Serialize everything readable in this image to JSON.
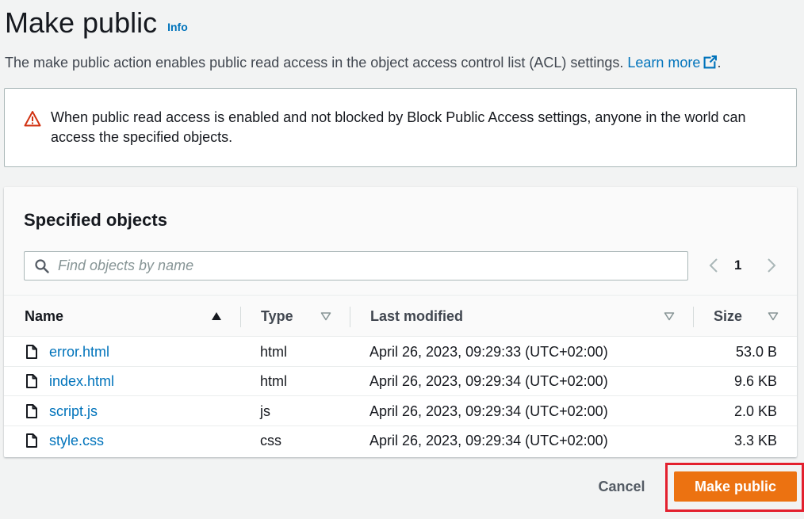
{
  "header": {
    "title": "Make public",
    "info_label": "Info"
  },
  "description": {
    "text": "The make public action enables public read access in the object access control list (ACL) settings. ",
    "learn_more": "Learn more",
    "trailing": "."
  },
  "alert": {
    "type": "warning",
    "text": "When public read access is enabled and not blocked by Block Public Access settings, anyone in the world can access the specified objects."
  },
  "objects_panel": {
    "title": "Specified objects",
    "search_placeholder": "Find objects by name",
    "search_value": "",
    "page_number": "1",
    "columns": {
      "name": "Name",
      "type": "Type",
      "last_modified": "Last modified",
      "size": "Size"
    },
    "sort": {
      "column": "Name",
      "direction": "ascending"
    },
    "rows": [
      {
        "name": "error.html",
        "type": "html",
        "last_modified": "April 26, 2023, 09:29:33 (UTC+02:00)",
        "size": "53.0 B"
      },
      {
        "name": "index.html",
        "type": "html",
        "last_modified": "April 26, 2023, 09:29:34 (UTC+02:00)",
        "size": "9.6 KB"
      },
      {
        "name": "script.js",
        "type": "js",
        "last_modified": "April 26, 2023, 09:29:34 (UTC+02:00)",
        "size": "2.0 KB"
      },
      {
        "name": "style.css",
        "type": "css",
        "last_modified": "April 26, 2023, 09:29:34 (UTC+02:00)",
        "size": "3.3 KB"
      }
    ]
  },
  "footer": {
    "cancel_label": "Cancel",
    "primary_label": "Make public"
  },
  "colors": {
    "link": "#0073bb",
    "primary_button": "#ec7211",
    "warning_icon": "#d13212",
    "highlight_border": "#e3202e"
  },
  "icons": {
    "external_link": "external-link-icon",
    "warning": "warning-icon",
    "search": "search-icon",
    "file": "file-icon",
    "sort_asc": "sort-ascending-icon",
    "sort_none": "sort-descending-outline-icon"
  }
}
